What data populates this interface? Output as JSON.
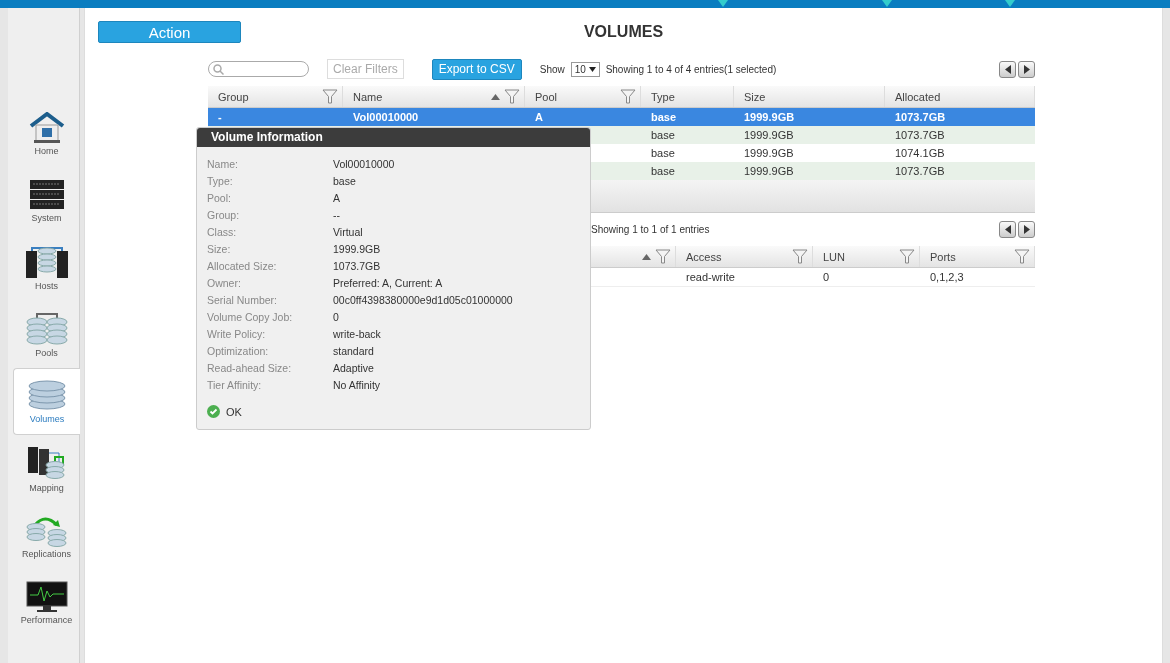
{
  "sidebar": {
    "items": [
      {
        "label": "Home",
        "kind": "home",
        "selected": false
      },
      {
        "label": "System",
        "kind": "system",
        "selected": false
      },
      {
        "label": "Hosts",
        "kind": "hosts",
        "selected": false
      },
      {
        "label": "Pools",
        "kind": "pools",
        "selected": false
      },
      {
        "label": "Volumes",
        "kind": "volumes",
        "selected": true
      },
      {
        "label": "Mapping",
        "kind": "mapping",
        "selected": false
      },
      {
        "label": "Replications",
        "kind": "replications",
        "selected": false
      },
      {
        "label": "Performance",
        "kind": "performance",
        "selected": false
      }
    ]
  },
  "action_button": "Action",
  "page_title": "VOLUMES",
  "volumes_table": {
    "clear_filters": "Clear Filters",
    "export_button": "Export to CSV",
    "show_label": "Show",
    "page_size": "10",
    "summary": "Showing 1 to 4 of 4 entries(1 selected)",
    "columns": [
      {
        "label": "Group",
        "sorted": false,
        "filter": true
      },
      {
        "label": "Name",
        "sorted": true,
        "filter": true
      },
      {
        "label": "Pool",
        "sorted": false,
        "filter": true
      },
      {
        "label": "Type",
        "sorted": false,
        "filter": false
      },
      {
        "label": "Size",
        "sorted": false,
        "filter": false
      },
      {
        "label": "Allocated",
        "sorted": false,
        "filter": false
      }
    ],
    "rows": [
      {
        "selected": true,
        "cells": [
          "-",
          "Vol00010000",
          "A",
          "base",
          "1999.9GB",
          "1073.7GB"
        ]
      },
      {
        "selected": false,
        "cells": [
          null,
          null,
          null,
          "base",
          "1999.9GB",
          "1073.7GB"
        ]
      },
      {
        "selected": false,
        "cells": [
          null,
          null,
          null,
          "base",
          "1999.9GB",
          "1074.1GB"
        ]
      },
      {
        "selected": false,
        "cells": [
          null,
          null,
          null,
          "base",
          "1999.9GB",
          "1073.7GB"
        ]
      }
    ]
  },
  "mapping_table": {
    "summary": "Showing 1 to 1 of 1 entries",
    "columns": [
      {
        "sorted": true,
        "filter": true
      },
      {
        "label": "Access",
        "sorted": false,
        "filter": true
      },
      {
        "label": "LUN",
        "sorted": false,
        "filter": true
      },
      {
        "label": "Ports",
        "sorted": false,
        "filter": true
      }
    ],
    "rows": [
      {
        "cells": [
          null,
          "read-write",
          "0",
          "0,1,2,3"
        ]
      }
    ]
  },
  "volume_information": {
    "title": "Volume Information",
    "fields": [
      {
        "label": "Name:",
        "value": "Vol00010000"
      },
      {
        "label": "Type:",
        "value": "base"
      },
      {
        "label": "Pool:",
        "value": "A"
      },
      {
        "label": "Group:",
        "value": "--"
      },
      {
        "label": "Class:",
        "value": "Virtual"
      },
      {
        "label": "Size:",
        "value": "1999.9GB"
      },
      {
        "label": "Allocated Size:",
        "value": "1073.7GB"
      },
      {
        "label": "Owner:",
        "value": "Preferred: A, Current: A"
      },
      {
        "label": "Serial Number:",
        "value": "00c0ff4398380000e9d1d05c01000000"
      },
      {
        "label": "Volume Copy Job:",
        "value": "0"
      },
      {
        "label": "Write Policy:",
        "value": "write-back"
      },
      {
        "label": "Optimization:",
        "value": "standard"
      },
      {
        "label": "Read-ahead Size:",
        "value": "Adaptive"
      },
      {
        "label": "Tier Affinity:",
        "value": "No Affinity"
      }
    ],
    "ok_button": "OK"
  }
}
